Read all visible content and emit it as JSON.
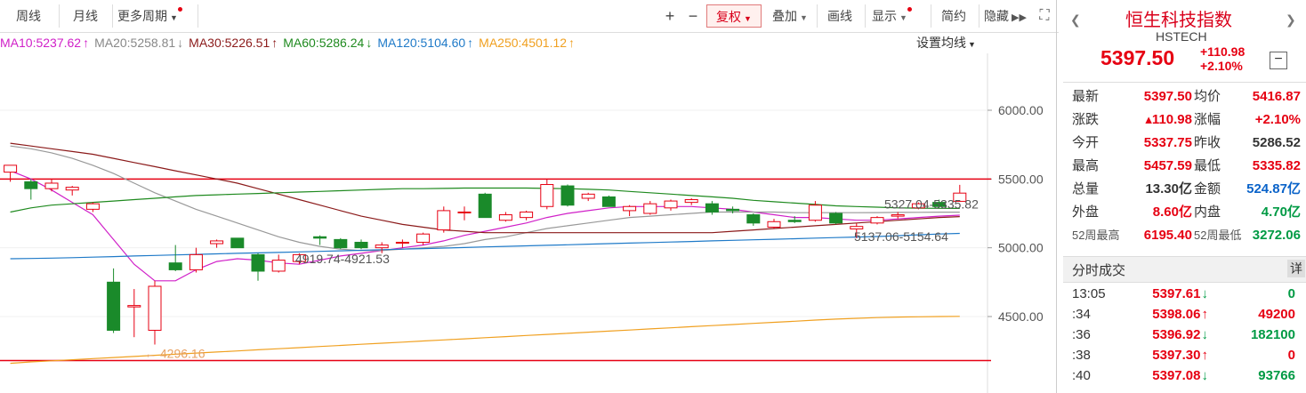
{
  "toolbar": {
    "week": "周线",
    "month": "月线",
    "more_periods": "更多周期",
    "plus": "+",
    "minus": "−",
    "restore_rights": "复权",
    "overlay": "叠加",
    "draw": "画线",
    "display": "显示",
    "compact": "简约",
    "hide": "隐藏"
  },
  "ma_legend": [
    {
      "label": "MA10:5237.62",
      "arrow": "↑",
      "color": "#d020c8"
    },
    {
      "label": "MA20:5258.81",
      "arrow": "↓",
      "color": "#888888"
    },
    {
      "label": "MA30:5226.51",
      "arrow": "↑",
      "color": "#8b1a1a"
    },
    {
      "label": "MA60:5286.24",
      "arrow": "↓",
      "color": "#1f8a1f"
    },
    {
      "label": "MA120:5104.60",
      "arrow": "↑",
      "color": "#1f7ac8"
    },
    {
      "label": "MA250:4501.12",
      "arrow": "↑",
      "color": "#f0a020"
    }
  ],
  "set_ma_label": "设置均线",
  "chart_data": {
    "type": "candlestick",
    "y_ticks": [
      6000,
      5500,
      5000,
      4500
    ],
    "y_tick_labels": [
      "6000.00",
      "5500.00",
      "5000.00",
      "4500.00"
    ],
    "ylim": [
      4100,
      6200
    ],
    "candles": [
      {
        "o": 5550,
        "h": 5600,
        "l": 5480,
        "c": 5600
      },
      {
        "o": 5480,
        "h": 5500,
        "l": 5350,
        "c": 5430
      },
      {
        "o": 5430,
        "h": 5500,
        "l": 5410,
        "c": 5470
      },
      {
        "o": 5420,
        "h": 5450,
        "l": 5380,
        "c": 5440
      },
      {
        "o": 5280,
        "h": 5330,
        "l": 5260,
        "c": 5320
      },
      {
        "o": 4750,
        "h": 4850,
        "l": 4380,
        "c": 4400
      },
      {
        "o": 4570,
        "h": 4700,
        "l": 4350,
        "c": 4580
      },
      {
        "o": 4400,
        "h": 4760,
        "l": 4296,
        "c": 4720
      },
      {
        "o": 4890,
        "h": 5020,
        "l": 4830,
        "c": 4840
      },
      {
        "o": 4840,
        "h": 5000,
        "l": 4820,
        "c": 4950
      },
      {
        "o": 5030,
        "h": 5060,
        "l": 5000,
        "c": 5050
      },
      {
        "o": 5070,
        "h": 5070,
        "l": 5000,
        "c": 5000
      },
      {
        "o": 4950,
        "h": 4960,
        "l": 4760,
        "c": 4830
      },
      {
        "o": 4830,
        "h": 4950,
        "l": 4820,
        "c": 4910
      },
      {
        "o": 4900,
        "h": 4960,
        "l": 4880,
        "c": 4950
      },
      {
        "o": 5080,
        "h": 5090,
        "l": 5020,
        "c": 5070
      },
      {
        "o": 5060,
        "h": 5070,
        "l": 4990,
        "c": 5000
      },
      {
        "o": 5040,
        "h": 5060,
        "l": 4990,
        "c": 5000
      },
      {
        "o": 5000,
        "h": 5040,
        "l": 4960,
        "c": 5020
      },
      {
        "o": 5040,
        "h": 5060,
        "l": 5000,
        "c": 5040
      },
      {
        "o": 5040,
        "h": 5110,
        "l": 5020,
        "c": 5100
      },
      {
        "o": 5130,
        "h": 5300,
        "l": 5110,
        "c": 5270
      },
      {
        "o": 5260,
        "h": 5300,
        "l": 5200,
        "c": 5260
      },
      {
        "o": 5390,
        "h": 5400,
        "l": 5220,
        "c": 5220
      },
      {
        "o": 5200,
        "h": 5260,
        "l": 5190,
        "c": 5240
      },
      {
        "o": 5220,
        "h": 5270,
        "l": 5200,
        "c": 5260
      },
      {
        "o": 5300,
        "h": 5500,
        "l": 5280,
        "c": 5460
      },
      {
        "o": 5450,
        "h": 5460,
        "l": 5300,
        "c": 5310
      },
      {
        "o": 5360,
        "h": 5400,
        "l": 5340,
        "c": 5390
      },
      {
        "o": 5370,
        "h": 5380,
        "l": 5300,
        "c": 5300
      },
      {
        "o": 5270,
        "h": 5310,
        "l": 5230,
        "c": 5300
      },
      {
        "o": 5250,
        "h": 5340,
        "l": 5240,
        "c": 5320
      },
      {
        "o": 5290,
        "h": 5350,
        "l": 5270,
        "c": 5340
      },
      {
        "o": 5330,
        "h": 5360,
        "l": 5310,
        "c": 5350
      },
      {
        "o": 5320,
        "h": 5340,
        "l": 5240,
        "c": 5260
      },
      {
        "o": 5280,
        "h": 5300,
        "l": 5250,
        "c": 5270
      },
      {
        "o": 5240,
        "h": 5250,
        "l": 5160,
        "c": 5180
      },
      {
        "o": 5150,
        "h": 5210,
        "l": 5140,
        "c": 5190
      },
      {
        "o": 5200,
        "h": 5230,
        "l": 5180,
        "c": 5190
      },
      {
        "o": 5200,
        "h": 5340,
        "l": 5190,
        "c": 5310
      },
      {
        "o": 5250,
        "h": 5260,
        "l": 5170,
        "c": 5180
      },
      {
        "o": 5137,
        "h": 5180,
        "l": 5070,
        "c": 5155
      },
      {
        "o": 5180,
        "h": 5230,
        "l": 5170,
        "c": 5220
      },
      {
        "o": 5230,
        "h": 5260,
        "l": 5210,
        "c": 5240
      },
      {
        "o": 5290,
        "h": 5330,
        "l": 5280,
        "c": 5320
      },
      {
        "o": 5330,
        "h": 5350,
        "l": 5290,
        "c": 5300
      },
      {
        "o": 5337.75,
        "h": 5457.59,
        "l": 5335.82,
        "c": 5397.5
      }
    ],
    "ma_series": {
      "MA10": [
        5560,
        5500,
        5420,
        5330,
        5240,
        5060,
        4880,
        4760,
        4760,
        4840,
        4900,
        4920,
        4910,
        4890,
        4880,
        4910,
        4940,
        4960,
        4980,
        5000,
        5020,
        5050,
        5090,
        5120,
        5150,
        5180,
        5220,
        5250,
        5270,
        5290,
        5300,
        5300,
        5300,
        5300,
        5290,
        5280,
        5260,
        5240,
        5220,
        5220,
        5210,
        5200,
        5200,
        5210,
        5220,
        5230,
        5237
      ],
      "MA20": [
        5740,
        5720,
        5690,
        5650,
        5600,
        5540,
        5470,
        5400,
        5340,
        5280,
        5230,
        5180,
        5130,
        5080,
        5040,
        5010,
        4990,
        4980,
        4980,
        4990,
        5000,
        5010,
        5030,
        5060,
        5080,
        5110,
        5140,
        5160,
        5180,
        5200,
        5220,
        5230,
        5240,
        5250,
        5260,
        5260,
        5260,
        5260,
        5255,
        5255,
        5255,
        5255,
        5256,
        5257,
        5258,
        5259,
        5258.81
      ],
      "MA30": [
        5760,
        5740,
        5720,
        5700,
        5680,
        5650,
        5620,
        5590,
        5560,
        5530,
        5500,
        5470,
        5430,
        5390,
        5350,
        5310,
        5270,
        5230,
        5200,
        5170,
        5150,
        5130,
        5120,
        5110,
        5110,
        5110,
        5110,
        5110,
        5110,
        5110,
        5110,
        5110,
        5110,
        5110,
        5110,
        5120,
        5130,
        5140,
        5150,
        5160,
        5170,
        5180,
        5190,
        5200,
        5210,
        5220,
        5226.51
      ],
      "MA60": [
        5260,
        5290,
        5310,
        5320,
        5330,
        5340,
        5350,
        5360,
        5370,
        5380,
        5385,
        5390,
        5395,
        5400,
        5405,
        5410,
        5415,
        5420,
        5425,
        5430,
        5430,
        5432,
        5434,
        5434,
        5434,
        5434,
        5432,
        5430,
        5425,
        5420,
        5410,
        5400,
        5390,
        5380,
        5370,
        5360,
        5345,
        5335,
        5325,
        5315,
        5305,
        5300,
        5295,
        5290,
        5288,
        5287,
        5286.24
      ],
      "MA120": [
        4920,
        4922,
        4925,
        4928,
        4932,
        4936,
        4940,
        4944,
        4948,
        4952,
        4956,
        4960,
        4963,
        4966,
        4970,
        4974,
        4978,
        4982,
        4986,
        4990,
        4994,
        4998,
        5002,
        5006,
        5010,
        5014,
        5018,
        5022,
        5026,
        5030,
        5034,
        5038,
        5042,
        5046,
        5050,
        5054,
        5058,
        5062,
        5066,
        5070,
        5074,
        5078,
        5082,
        5088,
        5094,
        5100,
        5104.6
      ],
      "MA250": [
        4160,
        4170,
        4178,
        4186,
        4194,
        4202,
        4210,
        4218,
        4226,
        4234,
        4242,
        4250,
        4258,
        4266,
        4274,
        4282,
        4290,
        4298,
        4306,
        4314,
        4322,
        4330,
        4338,
        4346,
        4354,
        4362,
        4370,
        4378,
        4386,
        4394,
        4402,
        4410,
        4418,
        4426,
        4434,
        4442,
        4450,
        4458,
        4466,
        4474,
        4481,
        4487,
        4492,
        4496,
        4498,
        4500,
        4501.12
      ]
    },
    "hlines": [
      5500,
      4180
    ],
    "annotations": {
      "low_label": "4296.16",
      "range1": "4919.74-4921.53",
      "range2": "5137.06-5154.64",
      "range3": "5327.04-5335.82"
    }
  },
  "panel": {
    "title": "恒生科技指数",
    "code": "HSTECH",
    "price": "5397.50",
    "change": "+110.98",
    "change_pct": "+2.10%",
    "minimize": "−",
    "quote": [
      {
        "l1": "最新",
        "v1": "5397.50",
        "c1": "red",
        "l2": "均价",
        "v2": "5416.87",
        "c2": "red"
      },
      {
        "l1": "涨跌",
        "v1": "▴110.98",
        "c1": "red",
        "l2": "涨幅",
        "v2": "+2.10%",
        "c2": "red"
      },
      {
        "l1": "今开",
        "v1": "5337.75",
        "c1": "red",
        "l2": "昨收",
        "v2": "5286.52",
        "c2": ""
      },
      {
        "l1": "最高",
        "v1": "5457.59",
        "c1": "red",
        "l2": "最低",
        "v2": "5335.82",
        "c2": "red"
      },
      {
        "l1": "总量",
        "v1": "13.30亿",
        "c1": "",
        "l2": "金额",
        "v2": "524.87亿",
        "c2": "blue"
      },
      {
        "l1": "外盘",
        "v1": "8.60亿",
        "c1": "red",
        "l2": "内盘",
        "v2": "4.70亿",
        "c2": "green"
      },
      {
        "l1": "52周最高",
        "v1": "6195.40",
        "c1": "red",
        "l2": "52周最低",
        "v2": "3272.06",
        "c2": "green"
      }
    ],
    "ts_title": "分时成交",
    "ts_detail": "详",
    "ticks": [
      {
        "t": "13:05",
        "p": "5397.61",
        "dir": "↓",
        "pc": "red",
        "ac": "green",
        "v": "0",
        "vc": "green"
      },
      {
        "t": ":34",
        "p": "5398.06",
        "dir": "↑",
        "pc": "red",
        "ac": "red",
        "v": "49200",
        "vc": "red"
      },
      {
        "t": ":36",
        "p": "5396.92",
        "dir": "↓",
        "pc": "red",
        "ac": "green",
        "v": "182100",
        "vc": "green"
      },
      {
        "t": ":38",
        "p": "5397.30",
        "dir": "↑",
        "pc": "red",
        "ac": "red",
        "v": "0",
        "vc": "red"
      },
      {
        "t": ":40",
        "p": "5397.08",
        "dir": "↓",
        "pc": "red",
        "ac": "green",
        "v": "93766",
        "vc": "green"
      }
    ]
  }
}
